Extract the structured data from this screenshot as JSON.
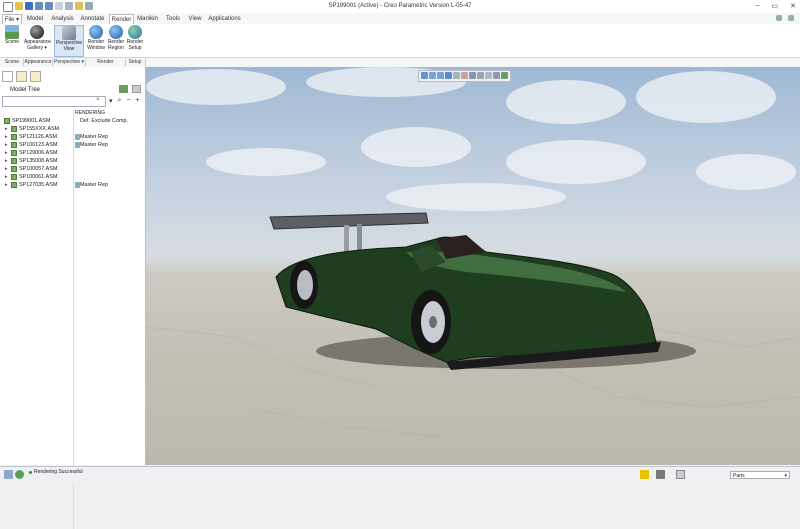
{
  "window": {
    "title": "SP199001 (Active) - Creo Parametric Version L-05-47",
    "controls": [
      "–",
      "▭",
      "✕"
    ]
  },
  "tabs": [
    {
      "label": "File ▾",
      "id": "file"
    },
    {
      "label": "Model",
      "id": "model"
    },
    {
      "label": "Analysis",
      "id": "analysis"
    },
    {
      "label": "Annotate",
      "id": "annotate"
    },
    {
      "label": "Render",
      "id": "render",
      "active": true
    },
    {
      "label": "Manikin",
      "id": "manikin"
    },
    {
      "label": "Tools",
      "id": "tools"
    },
    {
      "label": "View",
      "id": "view"
    },
    {
      "label": "Applications",
      "id": "applications"
    }
  ],
  "ribbon": {
    "scene": "Scene",
    "appearance_gallery": "Appearance Gallery ▾",
    "perspective_view": "Perspective View",
    "render_window": "Render Window",
    "render_region": "Render Region",
    "render_setup": "Render Setup"
  },
  "groups": {
    "scene": "Scene",
    "appearance": "Appearance",
    "perspective": "Perspective ▾",
    "render": "Render",
    "setup": "Setup"
  },
  "model_tree": {
    "label": "Model Tree",
    "column_header": "RENDERING",
    "rows": [
      {
        "name": "SP199001.ASM",
        "rep": "Def. Exclude Comp.",
        "top": true
      },
      {
        "name": "SP155XXX.ASM",
        "rep": ""
      },
      {
        "name": "SP121126.ASM",
        "rep": "Master Rep"
      },
      {
        "name": "SP100123.ASM",
        "rep": "Master Rep"
      },
      {
        "name": "SP129006.ASM",
        "rep": ""
      },
      {
        "name": "SP135008.ASM",
        "rep": ""
      },
      {
        "name": "SP100057.ASM",
        "rep": ""
      },
      {
        "name": "SP100061.ASM",
        "rep": ""
      },
      {
        "name": "SP127035.ASM",
        "rep": "Master Rep"
      }
    ]
  },
  "status": {
    "message": "Rendering Successful",
    "filter": "Parts"
  },
  "colors": {
    "car_body": "#1f3d1f",
    "accent_blue": "#2f6fbf"
  }
}
